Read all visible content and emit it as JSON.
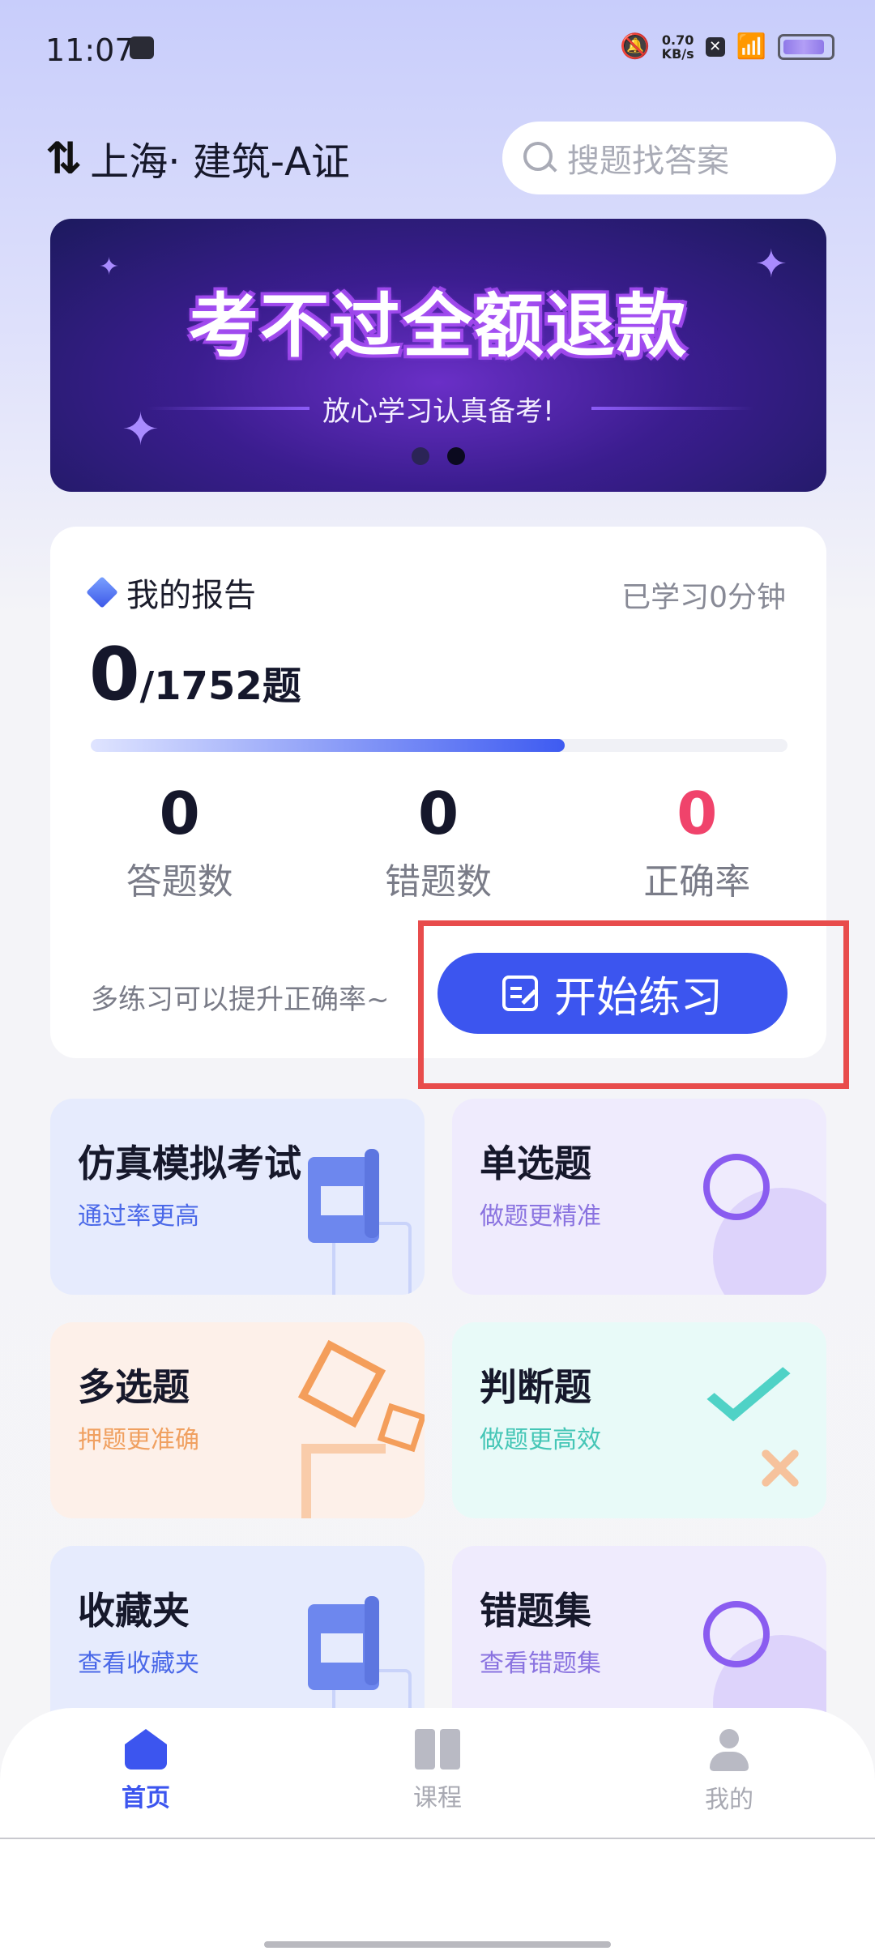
{
  "status_bar": {
    "time": "11:07",
    "speed_value": "0.70",
    "speed_unit": "KB/s",
    "x_badge": "✕"
  },
  "header": {
    "swap_icon": "⇅",
    "location": "上海· 建筑-A证",
    "search_placeholder": "搜题找答案"
  },
  "banner": {
    "headline": "考不过全额退款",
    "subtitle": "放心学习认真备考!",
    "slide_count": 2,
    "active_slide": 2
  },
  "report": {
    "title": "我的报告",
    "studied_time": "已学习0分钟",
    "done": "0",
    "total": "/1752题",
    "progress_fraction": 0.68,
    "stats": [
      {
        "value": "0",
        "label": "答题数"
      },
      {
        "value": "0",
        "label": "错题数"
      },
      {
        "value": "0",
        "label": "正确率"
      }
    ],
    "tip": "多练习可以提升正确率~",
    "start_button": "开始练习"
  },
  "tiles": [
    {
      "title": "仿真模拟考试",
      "subtitle": "通过率更高",
      "icon": "document-icon"
    },
    {
      "title": "单选题",
      "subtitle": "做题更精准",
      "icon": "circle-icon"
    },
    {
      "title": "多选题",
      "subtitle": "押题更准确",
      "icon": "squares-icon"
    },
    {
      "title": "判断题",
      "subtitle": "做题更高效",
      "icon": "check-cross-icon"
    },
    {
      "title": "收藏夹",
      "subtitle": "查看收藏夹",
      "icon": "document-icon"
    },
    {
      "title": "错题集",
      "subtitle": "查看错题集",
      "icon": "circle-icon"
    }
  ],
  "nav": {
    "items": [
      {
        "label": "首页",
        "icon": "home-icon",
        "active": true
      },
      {
        "label": "课程",
        "icon": "book-icon",
        "active": false
      },
      {
        "label": "我的",
        "icon": "user-icon",
        "active": false
      }
    ]
  },
  "colors": {
    "accent": "#3c55ef",
    "highlight_box": "#e84c4c",
    "correct_rate": "#f0436b"
  }
}
